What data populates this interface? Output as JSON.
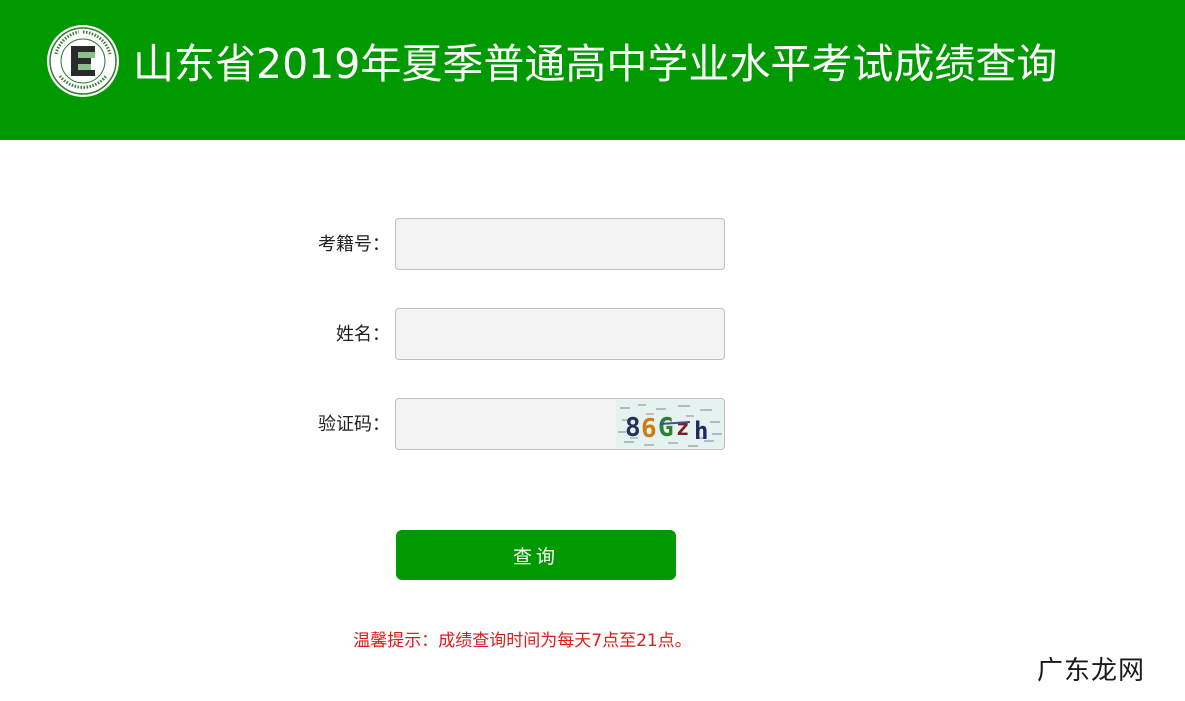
{
  "header": {
    "title": "山东省2019年夏季普通高中学业水平考试成绩查询",
    "logo": {
      "icon": "exam-authority-seal-icon",
      "letter": "E"
    }
  },
  "form": {
    "exam_id": {
      "label": "考籍号：",
      "value": "",
      "placeholder": ""
    },
    "name": {
      "label": "姓名：",
      "value": "",
      "placeholder": ""
    },
    "captcha": {
      "label": "验证码：",
      "value": "",
      "placeholder": "",
      "image_text": "86Gzh"
    }
  },
  "submit_label": "查询",
  "notice": "温馨提示：成绩查询时间为每天7点至21点。",
  "watermark": "广东龙网",
  "colors": {
    "brand_green": "#009a00",
    "notice_red": "#e0191b",
    "input_bg": "#f3f3f3"
  }
}
